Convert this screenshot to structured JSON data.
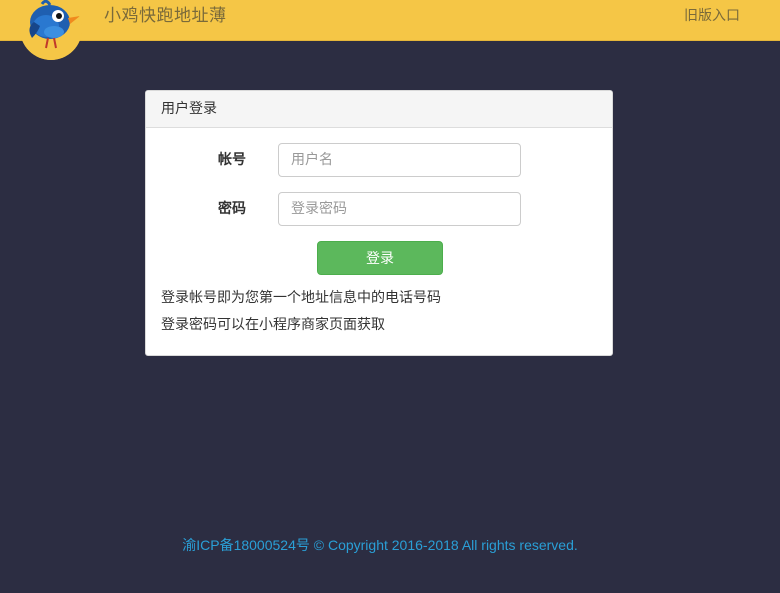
{
  "header": {
    "title": "小鸡快跑地址薄",
    "old_version_link": "旧版入口"
  },
  "login_panel": {
    "title": "用户登录",
    "account_label": "帐号",
    "account_placeholder": "用户名",
    "password_label": "密码",
    "password_placeholder": "登录密码",
    "submit_label": "登录",
    "note_1": "登录帐号即为您第一个地址信息中的电话号码",
    "note_2": "登录密码可以在小程序商家页面获取"
  },
  "footer": {
    "text": "渝ICP备18000524号 © Copyright 2016-2018 All rights reserved."
  },
  "colors": {
    "background": "#2c2d42",
    "topbar": "#f5c646",
    "primary_button": "#5cb85c",
    "footer_link": "#2a9fd6"
  }
}
